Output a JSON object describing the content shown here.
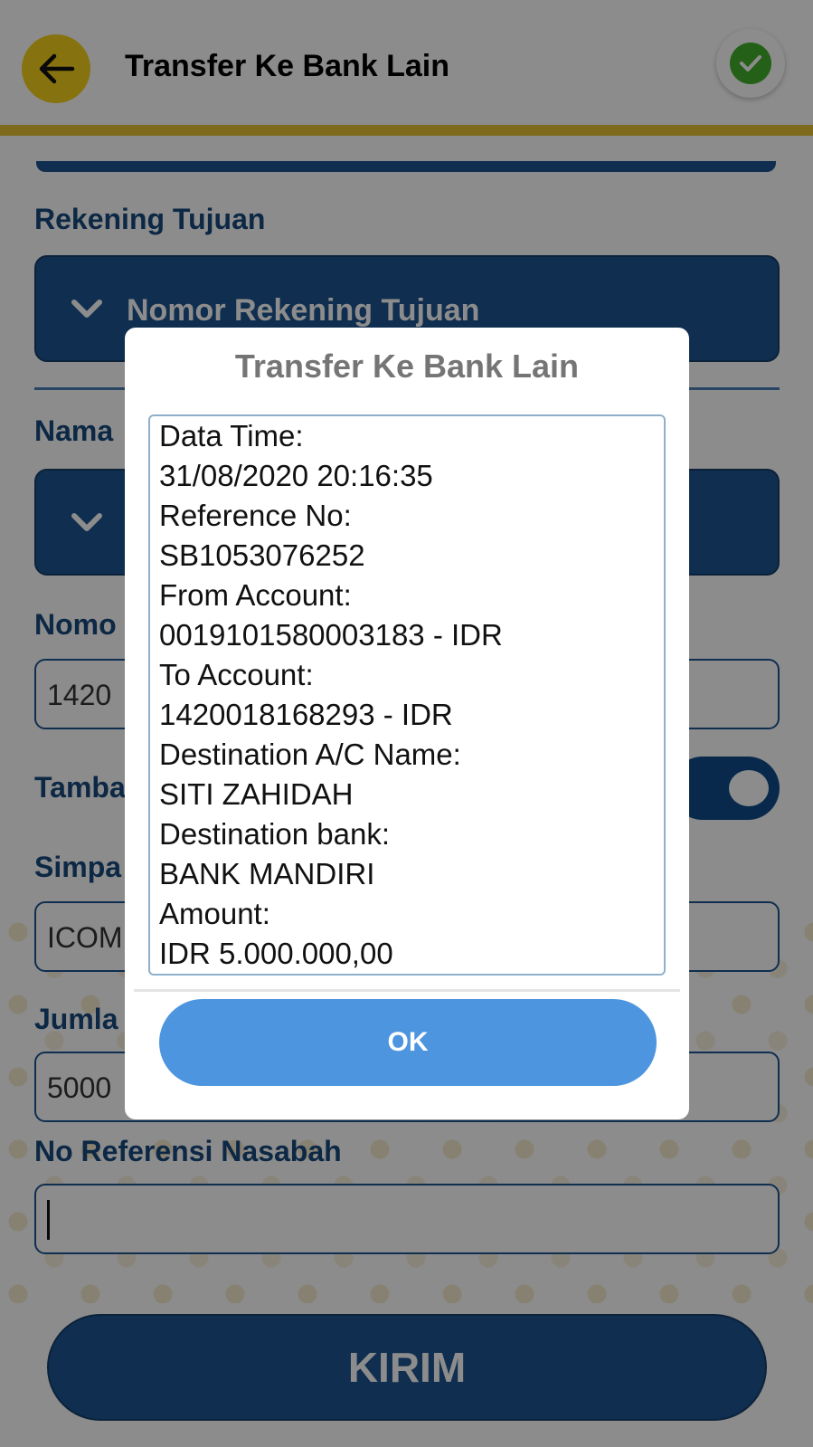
{
  "appbar": {
    "title": "Transfer Ke Bank Lain",
    "back_icon": "arrow-left-icon",
    "confirm_icon": "check-icon",
    "accent_color": "#f4d21c"
  },
  "form": {
    "rekening_tujuan_label": "Rekening Tujuan",
    "rekening_select_text": "Nomor Rekening Tujuan",
    "nama_label_partial": "Nama",
    "nomor_label_partial": "Nomo",
    "nomor_value_partial": "1420",
    "tambah_label_partial": "Tamba",
    "simpan_label_partial": "Simpa",
    "simpan_value_partial": "ICOM",
    "jumlah_label_partial": "Jumla",
    "jumlah_value_partial": "5000",
    "no_referensi_label": "No Referensi Nasabah",
    "submit_label": "KIRIM"
  },
  "dialog": {
    "title": "Transfer Ke Bank Lain",
    "lines": [
      "Data Time:",
      "31/08/2020 20:16:35",
      "Reference No:",
      "SB1053076252",
      "From Account:",
      "0019101580003183 - IDR",
      "To Account:",
      "1420018168293 - IDR",
      "Destination A/C Name:",
      "SITI ZAHIDAH",
      "Destination bank:",
      "BANK MANDIRI",
      "Amount:",
      "IDR 5.000.000,00"
    ],
    "ok_label": "OK"
  }
}
